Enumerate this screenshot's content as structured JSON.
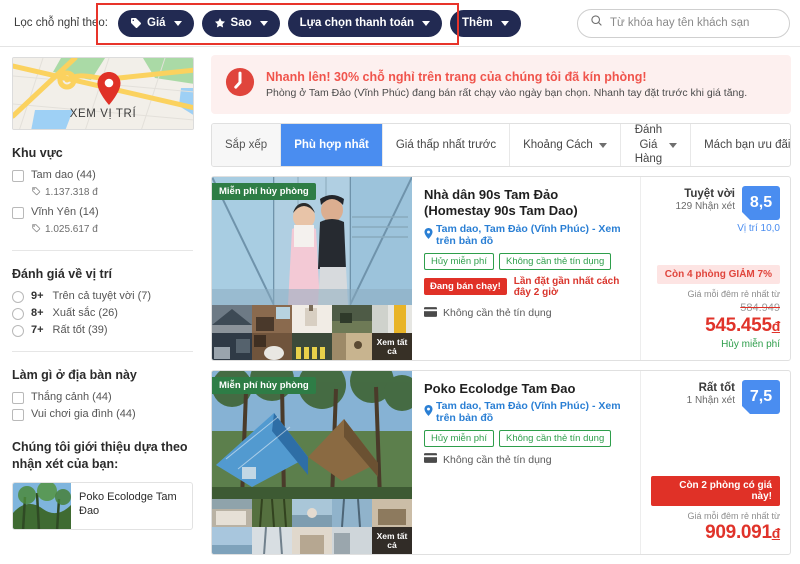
{
  "topbar": {
    "filter_label": "Lọc chỗ nghỉ theo:",
    "pills": [
      {
        "label": "Giá",
        "icon": "tag-icon",
        "caret": true
      },
      {
        "label": "Sao",
        "icon": "star-icon",
        "caret": true
      },
      {
        "label": "Lựa chọn thanh toán",
        "icon": "none",
        "caret": true
      },
      {
        "label": "Thêm",
        "icon": "none",
        "caret": true
      }
    ],
    "highlight_color": "#e8342a",
    "pill_color": "#222a52",
    "search": {
      "placeholder": "Từ khóa hay tên khách sạn",
      "value": "",
      "icon": "search-icon"
    }
  },
  "sidebar": {
    "map": {
      "label": "XEM VỊ TRÍ",
      "pin_icon": "map-pin-icon"
    },
    "sections": [
      {
        "title": "Khu vực",
        "type": "checkbox",
        "items": [
          {
            "label": "Tam dao (44)",
            "price": "1.137.318 đ",
            "price_icon": "tag-icon"
          },
          {
            "label": "Vĩnh Yên (14)",
            "price": "1.025.617 đ",
            "price_icon": "tag-icon"
          }
        ]
      },
      {
        "title": "Đánh giá về vị trí",
        "type": "radio",
        "items": [
          {
            "score": "9+",
            "label": "Trên cả tuyệt vời (7)"
          },
          {
            "score": "8+",
            "label": "Xuất sắc (26)"
          },
          {
            "score": "7+",
            "label": "Rất tốt (39)"
          }
        ]
      },
      {
        "title": "Làm gì ở địa bàn này",
        "type": "checkbox",
        "items": [
          {
            "label": "Thắng cảnh (44)"
          },
          {
            "label": "Vui chơi gia đình (44)"
          }
        ]
      }
    ],
    "recommendation": {
      "title": "Chúng tôi giới thiệu dựa theo nhận xét của bạn:",
      "hotel_name": "Poko Ecolodge Tam Đao"
    }
  },
  "main": {
    "alert": {
      "icon": "clock-icon",
      "headline": "Nhanh lên! 30% chỗ nghỉ trên trang của chúng tôi đã kín phòng!",
      "subline": "Phòng ở Tam Đảo (Vĩnh Phúc) đang bán rất chạy vào ngày bạn chọn. Nhanh tay đặt trước khi giá tăng.",
      "accent": "#f0544c"
    },
    "sort_tabs": [
      {
        "label": "Sắp xếp",
        "state": "head",
        "caret": false
      },
      {
        "label": "Phù hợp nhất",
        "state": "active",
        "caret": false
      },
      {
        "label": "Giá thấp nhất trước",
        "state": "normal",
        "caret": false
      },
      {
        "label": "Khoảng Cách",
        "state": "normal",
        "caret": true
      },
      {
        "label": "Được Đánh Giá Hàng Đầu",
        "state": "normal",
        "caret": true,
        "multiline": true
      },
      {
        "label": "Mách bạn ưu đãi",
        "state": "normal",
        "caret": false
      }
    ],
    "hotels": [
      {
        "ribbon": "Miễn phí hủy phòng",
        "name": "Nhà dân 90s Tam Đảo (Homestay 90s Tam Dao)",
        "location": "Tam dao, Tam Đảo (Vĩnh Phúc) - Xem trên bản đồ",
        "location_icon": "map-pin-icon",
        "tags": [
          "Hủy miễn phí",
          "Không cần thẻ tín dụng"
        ],
        "hot_badge": "Đang bán chạy!",
        "hot_note": "Lần đặt gần nhất cách đây 2 giờ",
        "no_card_icon": "credit-card-icon",
        "no_card_text": "Không cần thẻ tín dụng",
        "gallery_seeall": "Xem tất cả",
        "rating_word": "Tuyệt vời",
        "rating_reviews": "129 Nhận xét",
        "rating_score": "8,5",
        "rating_sub": "Vị trí 10,0",
        "offer_badge": "Còn 4 phòng GIẢM 7%",
        "offer_badge_style": "pink",
        "price_note": "Giá mỗi đêm rẻ nhất từ",
        "price_old": "584.949",
        "price_new": "545.455",
        "currency": "đ",
        "free_cancel": "Hủy miễn phí"
      },
      {
        "ribbon": "Miễn phí hủy phòng",
        "name": "Poko Ecolodge Tam Đao",
        "location": "Tam dao, Tam Đảo (Vĩnh Phúc) - Xem trên bản đồ",
        "location_icon": "map-pin-icon",
        "tags": [
          "Hủy miễn phí",
          "Không cần thẻ tín dụng"
        ],
        "hot_badge": "",
        "hot_note": "",
        "no_card_icon": "credit-card-icon",
        "no_card_text": "Không cần thẻ tín dụng",
        "gallery_seeall": "Xem tất cả",
        "rating_word": "Rất tốt",
        "rating_reviews": "1 Nhận xét",
        "rating_score": "7,5",
        "rating_sub": "",
        "offer_badge": "Còn 2 phòng có giá này!",
        "offer_badge_style": "red",
        "price_note": "Giá mỗi đêm rẻ nhất từ",
        "price_old": "",
        "price_new": "909.091",
        "currency": "đ",
        "free_cancel": ""
      }
    ]
  }
}
